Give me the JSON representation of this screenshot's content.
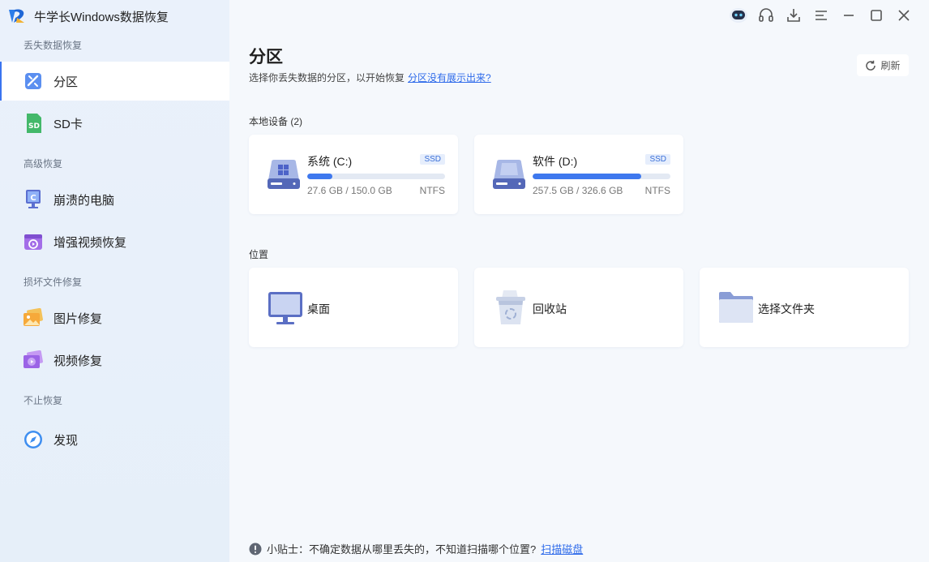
{
  "app": {
    "title": "牛学长Windows数据恢复"
  },
  "sidebar": {
    "groups": [
      {
        "label": "丢失数据恢复"
      },
      {
        "label": "高级恢复"
      },
      {
        "label": "损坏文件修复"
      },
      {
        "label": "不止恢复"
      }
    ],
    "items": [
      {
        "label": "分区",
        "icon": "partition-icon"
      },
      {
        "label": "SD卡",
        "icon": "sd-card-icon"
      },
      {
        "label": "崩溃的电脑",
        "icon": "crashed-pc-icon"
      },
      {
        "label": "增强视频恢复",
        "icon": "video-recovery-icon"
      },
      {
        "label": "图片修复",
        "icon": "photo-repair-icon"
      },
      {
        "label": "视频修复",
        "icon": "video-repair-icon"
      },
      {
        "label": "发现",
        "icon": "compass-icon"
      }
    ]
  },
  "main": {
    "title": "分区",
    "subtitle": "选择你丢失数据的分区，以开始恢复",
    "subtitle_link": "分区没有展示出来?",
    "refresh_label": "刷新",
    "local_devices_label": "本地设备 (2)",
    "drives": [
      {
        "name": "系统 (C:)",
        "badge": "SSD",
        "size": "27.6 GB / 150.0 GB",
        "fs": "NTFS",
        "used_fraction": 0.184
      },
      {
        "name": "软件 (D:)",
        "badge": "SSD",
        "size": "257.5 GB / 326.6 GB",
        "fs": "NTFS",
        "used_fraction": 0.788
      }
    ],
    "locations_label": "位置",
    "locations": [
      {
        "label": "桌面",
        "icon": "desktop-icon"
      },
      {
        "label": "回收站",
        "icon": "recycle-bin-icon"
      },
      {
        "label": "选择文件夹",
        "icon": "folder-icon"
      }
    ],
    "tip_text": "小贴士：不确定数据从哪里丢失的，不知道扫描哪个位置?",
    "tip_link": "扫描磁盘"
  },
  "colors": {
    "accent": "#3e78ee",
    "link": "#2f6bea",
    "sidebar_bg": "#e9f0fa"
  }
}
